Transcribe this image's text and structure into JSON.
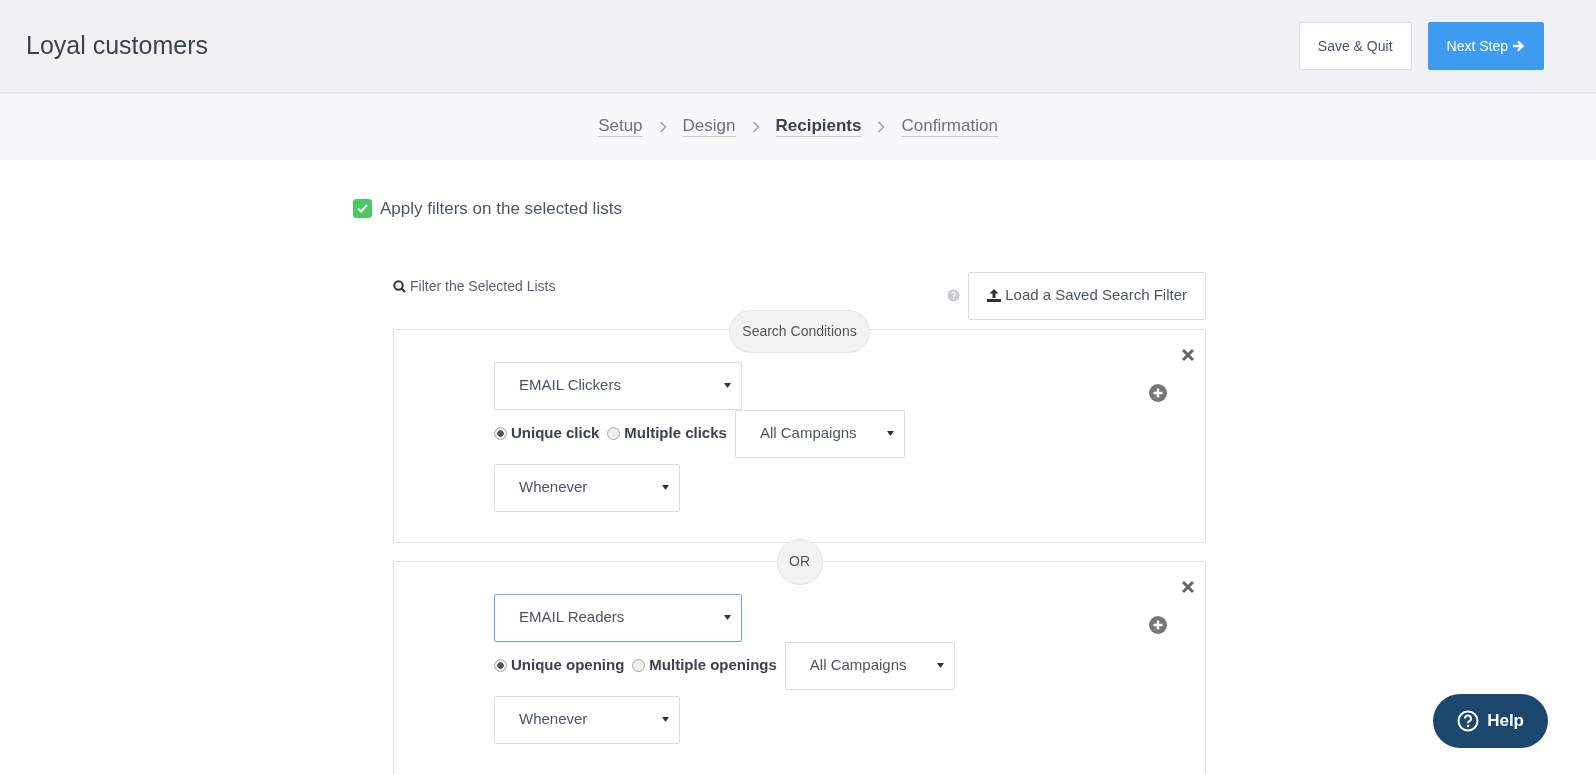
{
  "header": {
    "title": "Loyal customers",
    "buttons": [
      {
        "label": "Save & Quit",
        "kind": "secondary"
      },
      {
        "label": "Next Step",
        "kind": "primary"
      }
    ]
  },
  "steps": [
    {
      "label": "Setup",
      "selected": false
    },
    {
      "label": "Design",
      "selected": false
    },
    {
      "label": "Recipients",
      "selected": true
    },
    {
      "label": "Confirmation",
      "selected": false
    }
  ],
  "apply_filters": {
    "label": "Apply filters on the selected lists",
    "checked": true
  },
  "filter_panel": {
    "title": "Filter the Selected Lists",
    "load_button": "Load a Saved Search Filter",
    "conditions_label": "Search Conditions"
  },
  "conditions": [
    {
      "type": "EMAIL Clickers",
      "focused": false,
      "options": [
        {
          "label": "Unique click",
          "selected": true
        },
        {
          "label": "Multiple clicks",
          "selected": false
        }
      ],
      "campaign": "All Campaigns",
      "timing": "Whenever"
    },
    {
      "separator": "OR",
      "type": "EMAIL Readers",
      "focused": true,
      "options": [
        {
          "label": "Unique opening",
          "selected": true
        },
        {
          "label": "Multiple openings",
          "selected": false
        }
      ],
      "campaign": "All Campaigns",
      "timing": "Whenever"
    }
  ],
  "help_button": "Help"
}
